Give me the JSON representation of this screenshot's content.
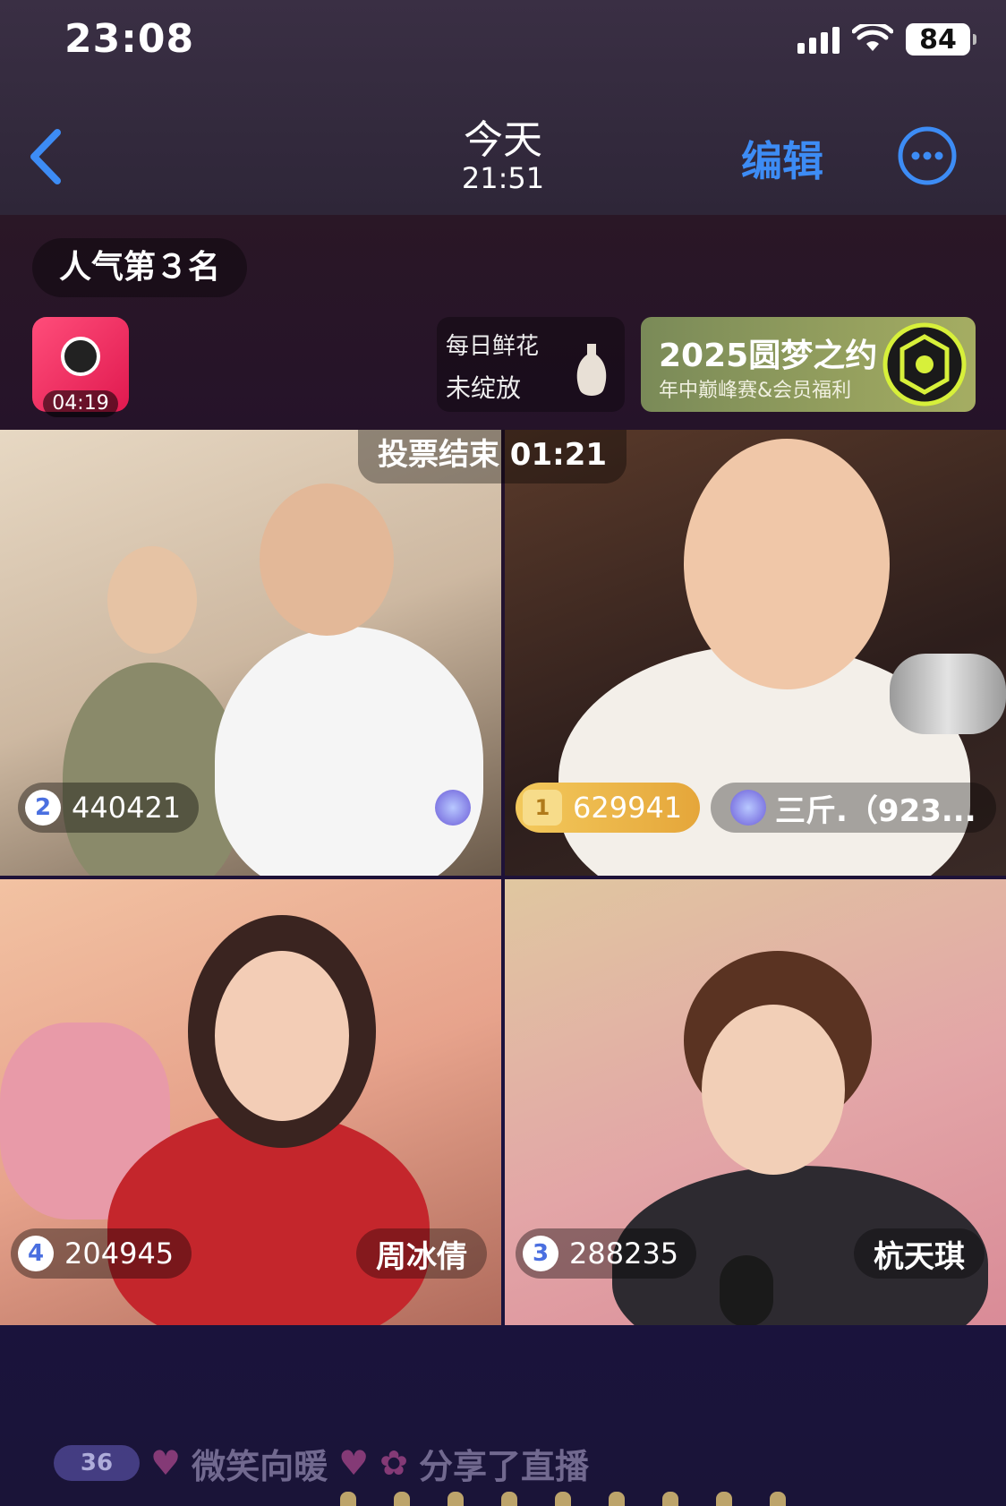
{
  "status_bar": {
    "time": "23:08",
    "battery": "84",
    "icons": [
      "signal-icon",
      "wifi-icon",
      "battery-icon"
    ]
  },
  "nav": {
    "title": "今天",
    "subtitle": "21:51",
    "edit_label": "编辑",
    "back_icon": "chevron-left-icon",
    "more_icon": "more-icon",
    "accent_color": "#3d8cf5"
  },
  "live": {
    "rank_label": "人气第３名",
    "gift_timer": "04:19",
    "flower": {
      "line1": "每日鲜花",
      "line2": "未绽放"
    },
    "event": {
      "title": "2025圆梦之约",
      "subtitle": "年中巅峰赛&会员福利"
    },
    "vote_timer": "投票结束 01:21",
    "streams": [
      {
        "rank": "2",
        "score": "440421",
        "name": ""
      },
      {
        "rank": "1",
        "score": "629941",
        "name": "三斤.（923..."
      },
      {
        "rank": "4",
        "score": "204945",
        "name": "周冰倩"
      },
      {
        "rank": "3",
        "score": "288235",
        "name": "杭天琪"
      }
    ],
    "chat": {
      "level": "36",
      "user": "微笑向暖",
      "message": "分享了直播"
    }
  }
}
